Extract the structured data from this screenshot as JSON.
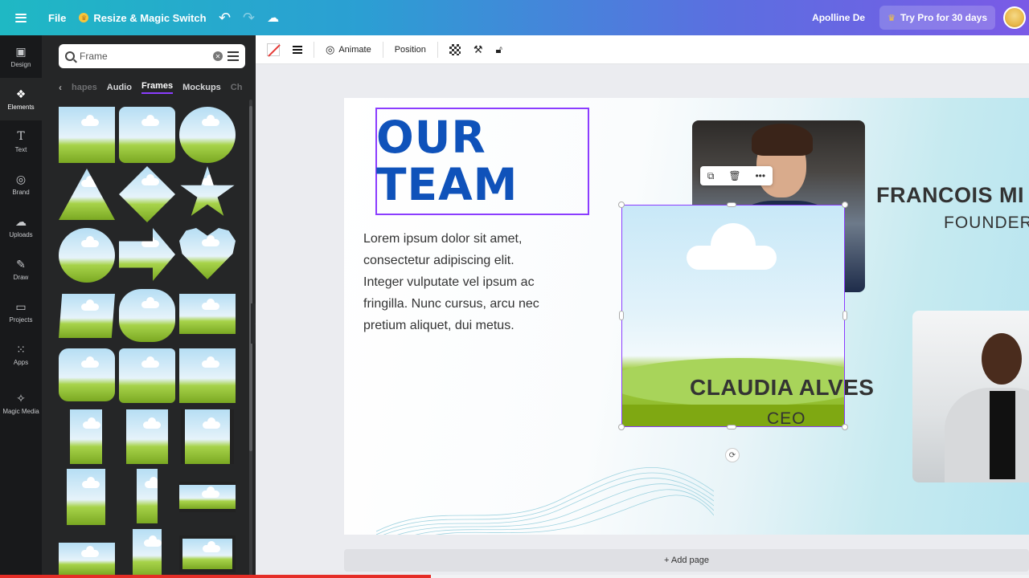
{
  "topbar": {
    "file_label": "File",
    "resize_label": "Resize & Magic Switch",
    "user_name": "Apolline De",
    "try_pro_label": "Try Pro for 30 days"
  },
  "rail": {
    "items": [
      {
        "label": "Design",
        "icon": "design-icon"
      },
      {
        "label": "Elements",
        "icon": "elements-icon"
      },
      {
        "label": "Text",
        "icon": "text-icon"
      },
      {
        "label": "Brand",
        "icon": "brand-icon"
      },
      {
        "label": "Uploads",
        "icon": "uploads-icon"
      },
      {
        "label": "Draw",
        "icon": "draw-icon"
      },
      {
        "label": "Projects",
        "icon": "projects-icon"
      },
      {
        "label": "Apps",
        "icon": "apps-icon"
      },
      {
        "label": "Magic Media",
        "icon": "magic-media-icon"
      }
    ]
  },
  "panel": {
    "search_value": "Frame",
    "tabs": [
      "hapes",
      "Audio",
      "Frames",
      "Mockups",
      "Ch"
    ]
  },
  "toolbar": {
    "animate_label": "Animate",
    "position_label": "Position"
  },
  "slide": {
    "title_line1": "OUR",
    "title_line2": "TEAM",
    "body_lines": [
      "Lorem ipsum dolor sit amet,",
      "consectetur adipiscing elit.",
      "Integer vulputate vel ipsum ac",
      "fringilla. Nunc cursus, arcu nec",
      "pretium aliquet, dui metus."
    ],
    "member1_name": "CLAUDIA ALVES",
    "member1_role": "CEO",
    "member2_name": "FRANCOIS MI",
    "member2_role": "FOUNDER"
  },
  "add_page_label": "+ Add page",
  "colors": {
    "accent": "#8b3dff",
    "title_blue": "#0f52ba"
  }
}
